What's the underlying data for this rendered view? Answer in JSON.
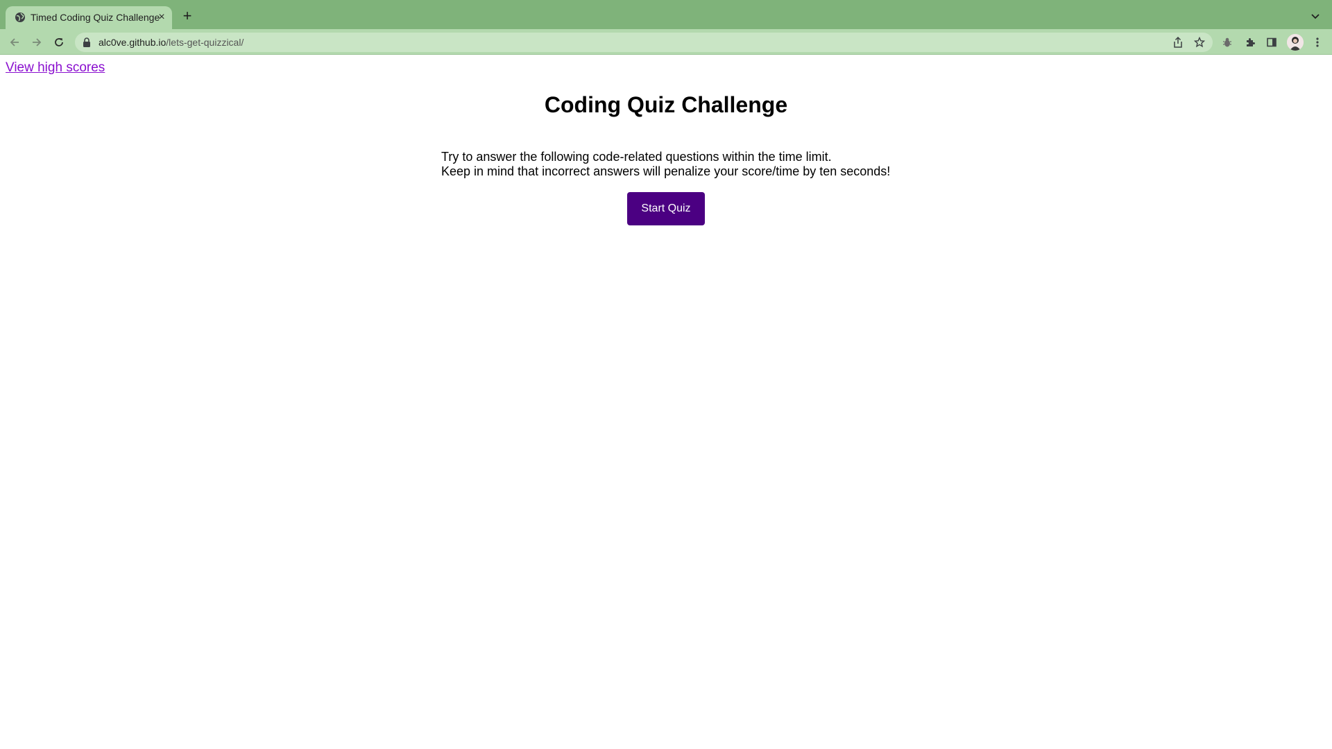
{
  "browser": {
    "tab_title": "Timed Coding Quiz Challenge",
    "tab_close": "×",
    "new_tab": "+",
    "url_host": "alc0ve.github.io",
    "url_path": "/lets-get-quizzical/"
  },
  "page": {
    "high_scores_link": "View high scores",
    "title": "Coding Quiz Challenge",
    "instruction_line_1": "Try to answer the following code-related questions within the time limit.",
    "instruction_line_2": "Keep in mind that incorrect answers will penalize your score/time by ten seconds!",
    "start_button": "Start Quiz"
  },
  "colors": {
    "tabbar": "#7fb37a",
    "toolbar": "#b3d9ae",
    "link": "#8a0fcf",
    "button": "#4b0082"
  },
  "icons": [
    "globe-icon",
    "close-icon",
    "plus-icon",
    "chevron-down-icon",
    "back-icon",
    "forward-icon",
    "reload-icon",
    "lock-icon",
    "share-icon",
    "star-icon",
    "bug-icon",
    "extensions-icon",
    "side-panel-icon",
    "avatar",
    "menu-icon"
  ]
}
